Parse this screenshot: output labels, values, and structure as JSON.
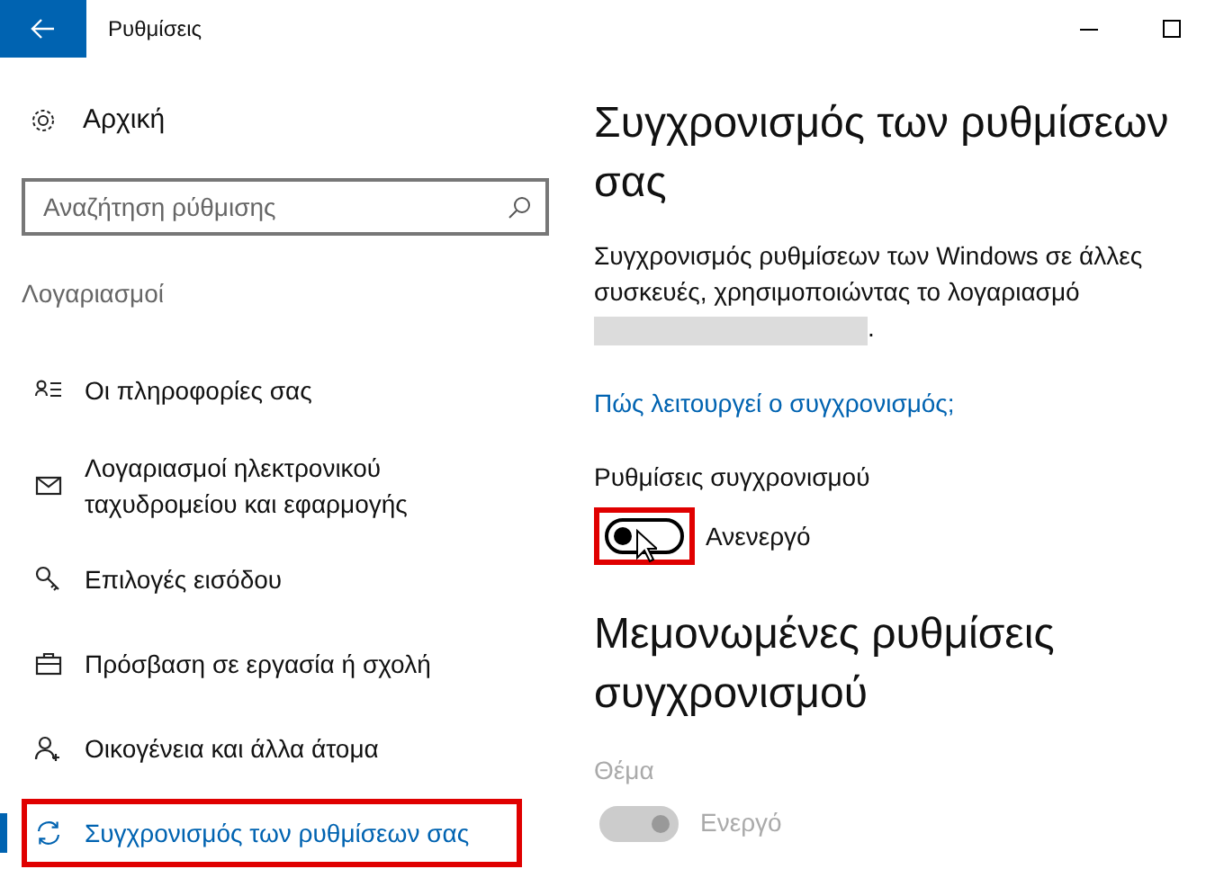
{
  "window": {
    "title": "Ρυθμίσεις"
  },
  "sidebar": {
    "home": "Αρχική",
    "search": {
      "placeholder": "Αναζήτηση ρύθμισης"
    },
    "section": "Λογαριασμοί",
    "items": [
      {
        "kind": "person-list",
        "label": "Οι πληροφορίες σας",
        "selected": false,
        "highlighted": false
      },
      {
        "kind": "mail",
        "label": "Λογαριασμοί ηλεκτρονικού ταχυδρομείου και εφαρμογής",
        "selected": false,
        "highlighted": false
      },
      {
        "kind": "key",
        "label": "Επιλογές εισόδου",
        "selected": false,
        "highlighted": false
      },
      {
        "kind": "briefcase",
        "label": "Πρόσβαση σε εργασία ή σχολή",
        "selected": false,
        "highlighted": false
      },
      {
        "kind": "person-add",
        "label": "Οικογένεια και άλλα άτομα",
        "selected": false,
        "highlighted": false
      },
      {
        "kind": "sync",
        "label": "Συγχρονισμός των ρυθμίσεων σας",
        "selected": true,
        "highlighted": true
      }
    ]
  },
  "content": {
    "title": "Συγχρονισμός των ρυθμίσεων σας",
    "description": "Συγχρονισμός ρυθμίσεων των Windows σε άλλες συσκευές, χρησιμοποιώντας το λογαριασμό",
    "description_end": ".",
    "link": "Πώς λειτουργεί ο συγχρονισμός;",
    "sync_setting": {
      "label": "Ρυθμίσεις συγχρονισμού",
      "on": false,
      "disabled": false,
      "highlighted": true,
      "state_text": "Ανενεργό"
    },
    "section_title": "Μεμονωμένες ρυθμίσεις συγχρονισμού",
    "settings": [
      {
        "label": "Θέμα",
        "on": true,
        "disabled": true,
        "state_text": "Ενεργό"
      }
    ]
  }
}
